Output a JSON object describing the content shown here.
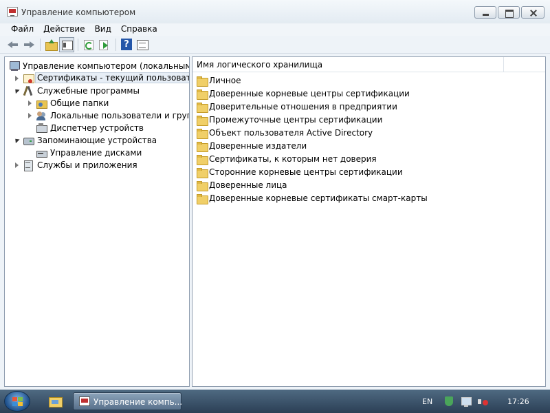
{
  "window": {
    "title": "Управление компьютером",
    "controls": [
      "minimize",
      "maximize",
      "close"
    ]
  },
  "menu": [
    "Файл",
    "Действие",
    "Вид",
    "Справка"
  ],
  "toolbar": {
    "icons": [
      "back-arrow-icon",
      "forward-arrow-icon",
      "up-folder-icon",
      "show-hide-tree-icon",
      "refresh-icon",
      "export-list-icon",
      "help-icon",
      "properties-icon"
    ]
  },
  "tree": {
    "items": [
      {
        "label": "Управление компьютером (локальным)",
        "icon": "computer-management-icon",
        "level": 0,
        "expander": "none"
      },
      {
        "label": "Сертификаты - текущий пользователь",
        "icon": "certificate-icon",
        "level": 1,
        "expander": "collapsed",
        "selected": true
      },
      {
        "label": "Служебные программы",
        "icon": "tools-icon",
        "level": 1,
        "expander": "expanded"
      },
      {
        "label": "Общие папки",
        "icon": "shared-folder-icon",
        "level": 2,
        "expander": "collapsed"
      },
      {
        "label": "Локальные пользователи и группы",
        "icon": "users-icon",
        "level": 2,
        "expander": "collapsed"
      },
      {
        "label": "Диспетчер устройств",
        "icon": "device-manager-icon",
        "level": 2,
        "expander": "none"
      },
      {
        "label": "Запоминающие устройства",
        "icon": "storage-icon",
        "level": 1,
        "expander": "expanded"
      },
      {
        "label": "Управление дисками",
        "icon": "disk-icon",
        "level": 2,
        "expander": "none"
      },
      {
        "label": "Службы и приложения",
        "icon": "services-icon",
        "level": 1,
        "expander": "collapsed"
      }
    ]
  },
  "list": {
    "column_header": "Имя логического хранилища",
    "rows": [
      "Личное",
      "Доверенные корневые центры сертификации",
      "Доверительные отношения в предприятии",
      "Промежуточные центры сертификации",
      "Объект пользователя Active Directory",
      "Доверенные издатели",
      "Сертификаты, к которым нет доверия",
      "Сторонние корневые центры сертификации",
      "Доверенные лица",
      "Доверенные корневые сертификаты смарт-карты"
    ]
  },
  "taskbar": {
    "task_label": "Управление компь...",
    "language": "EN",
    "clock": "17:26"
  }
}
